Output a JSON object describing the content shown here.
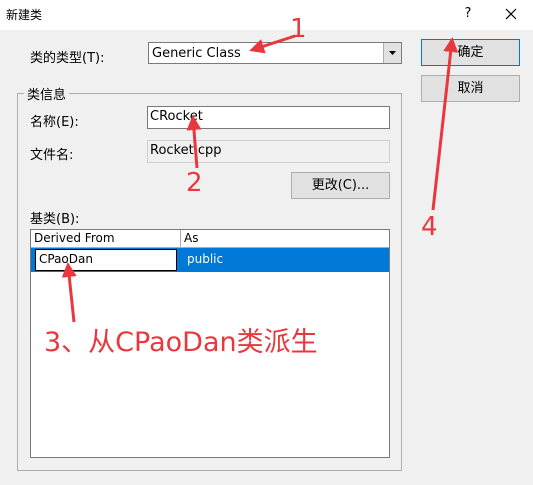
{
  "window": {
    "title": "新建类",
    "help": "?",
    "close_icon": "close-icon"
  },
  "class_type": {
    "label": "类的类型(T):",
    "value": "Generic Class"
  },
  "buttons": {
    "ok": "确定",
    "cancel": "取消",
    "change": "更改(C)..."
  },
  "class_info": {
    "group_title": "类信息",
    "name_label": "名称(E):",
    "name_value": "CRocket",
    "file_label": "文件名:",
    "file_value": "Rocket.cpp"
  },
  "base_class": {
    "label": "基类(B):",
    "columns": [
      "Derived From",
      "As"
    ],
    "rows": [
      {
        "derived_from": "CPaoDan",
        "as": "public"
      }
    ]
  },
  "annotations": {
    "n1": "1",
    "n2": "2",
    "n3": "3、从CPaoDan类派生",
    "n4": "4",
    "color": "#e8383d"
  },
  "colors": {
    "selection": "#0078d7",
    "face": "#f0f0f0"
  }
}
